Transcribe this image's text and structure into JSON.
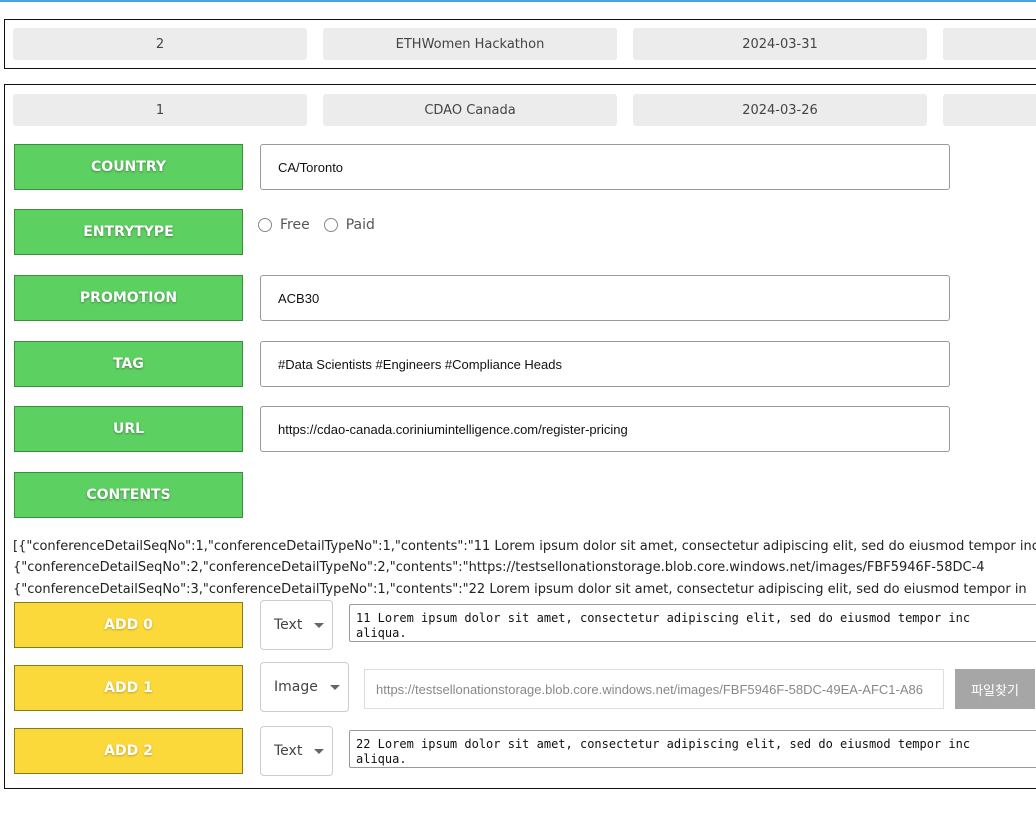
{
  "rows": [
    {
      "no": "2",
      "name": "ETHWomen Hackathon",
      "date": "2024-03-31"
    },
    {
      "no": "1",
      "name": "CDAO Canada",
      "date": "2024-03-26"
    }
  ],
  "detail": {
    "country_label": "COUNTRY",
    "country_value": "CA/Toronto",
    "entrytype_label": "ENTRYTYPE",
    "entry_options": [
      "Free",
      "Paid"
    ],
    "promotion_label": "PROMOTION",
    "promotion_value": "ACB30",
    "tag_label": "TAG",
    "tag_value": "#Data Scientists #Engineers #Compliance Heads",
    "url_label": "URL",
    "url_value": "https://cdao-canada.coriniumintelligence.com/register-pricing",
    "contents_label": "CONTENTS"
  },
  "json_lines": [
    "[{\"conferenceDetailSeqNo\":1,\"conferenceDetailTypeNo\":1,\"contents\":\"11 Lorem ipsum dolor sit amet, consectetur adipiscing elit, sed do eiusmod tempor inc",
    "{\"conferenceDetailSeqNo\":2,\"conferenceDetailTypeNo\":2,\"contents\":\"https://testsellonationstorage.blob.core.windows.net/images/FBF5946F-58DC-4",
    "{\"conferenceDetailSeqNo\":3,\"conferenceDetailTypeNo\":1,\"contents\":\"22 Lorem ipsum dolor sit amet, consectetur adipiscing elit, sed do eiusmod tempor in"
  ],
  "adds": [
    {
      "label": "ADD 0",
      "type": "Text",
      "content": "11 Lorem ipsum dolor sit amet, consectetur adipiscing elit, sed do eiusmod tempor inc\naliqua."
    },
    {
      "label": "ADD 1",
      "type": "Image",
      "content": "https://testsellonationstorage.blob.core.windows.net/images/FBF5946F-58DC-49EA-AFC1-A86",
      "button": "파일찾기"
    },
    {
      "label": "ADD 2",
      "type": "Text",
      "content": "22 Lorem ipsum dolor sit amet, consectetur adipiscing elit, sed do eiusmod tempor inc\naliqua."
    }
  ],
  "colors": {
    "green": "#5dd062",
    "yellow": "#fcd93b",
    "grey_cell": "#ececec",
    "file_button": "#a6a6a6"
  }
}
